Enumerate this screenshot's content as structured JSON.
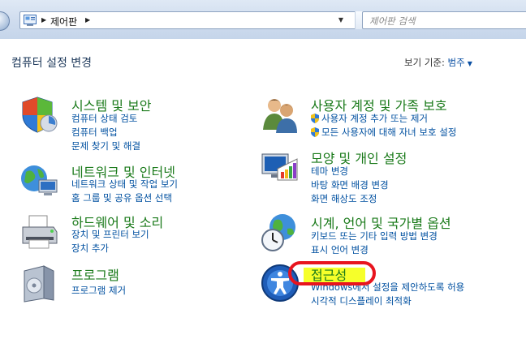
{
  "address_bar": {
    "breadcrumb": "제어판",
    "dropdown_icon": "chevron-down-icon",
    "refresh_icon": "refresh-icon"
  },
  "search": {
    "placeholder": "제어판 검색"
  },
  "header": {
    "title": "컴퓨터 설정 변경",
    "view_by_label": "보기 기준:",
    "view_by_value": "범주"
  },
  "categories": {
    "system_security": {
      "icon": "shield-icon",
      "title": "시스템 및 보안",
      "links": [
        "컴퓨터 상태 검토",
        "컴퓨터 백업",
        "문제 찾기 및 해결"
      ]
    },
    "user_accounts": {
      "icon": "users-icon",
      "title": "사용자 계정 및 가족 보호",
      "links": [
        "사용자 계정 추가 또는 제거",
        "모든 사용자에 대해 자녀 보호 설정"
      ]
    },
    "network": {
      "icon": "network-globe-icon",
      "title": "네트워크 및 인터넷",
      "links": [
        "네트워크 상태 및 작업 보기",
        "홈 그룹 및 공유 옵션 선택"
      ]
    },
    "appearance": {
      "icon": "display-palette-icon",
      "title": "모양 및 개인 설정",
      "links": [
        "테마 변경",
        "바탕 화면 배경 변경",
        "화면 해상도 조정"
      ]
    },
    "hardware": {
      "icon": "printer-icon",
      "title": "하드웨어 및 소리",
      "links": [
        "장치 및 프린터 보기",
        "장치 추가"
      ]
    },
    "clock": {
      "icon": "clock-globe-icon",
      "title": "시계, 언어 및 국가별 옵션",
      "links": [
        "키보드 또는 기타 입력 방법 변경",
        "표시 언어 변경"
      ]
    },
    "programs": {
      "icon": "programs-box-icon",
      "title": "프로그램",
      "links": [
        "프로그램 제거"
      ]
    },
    "ease_of_access": {
      "icon": "ease-of-access-icon",
      "title": "접근성",
      "links": [
        "Windows에서 설정을 제안하도록 허용",
        "시각적 디스플레이 최적화"
      ]
    }
  },
  "annotation": {
    "highlight_color": "#f6ff2a",
    "oval_color": "#e8141e"
  }
}
